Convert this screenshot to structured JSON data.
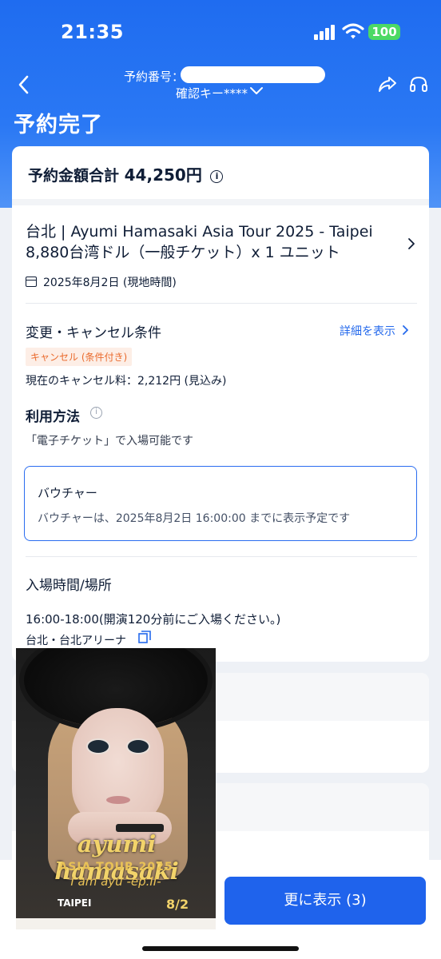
{
  "status_bar": {
    "time": "21:35",
    "battery": "100"
  },
  "nav": {
    "booking_label": "予約番号：",
    "confirm_key": "確認キー****"
  },
  "page_title": "予約完了",
  "summary": {
    "total_label": "予約金額合計",
    "total_amount": "44,250円"
  },
  "event": {
    "title_line1": "台北 | Ayumi Hamasaki Asia Tour 2025 - Taipei",
    "title_line2": "8,880台湾ドル（一般チケット）x 1 ユニット",
    "date": "2025年8月2日 (現地時間)"
  },
  "cancellation": {
    "heading": "変更・キャンセル条件",
    "details_link": "詳細を表示",
    "badge": "キャンセル (条件付き)",
    "fee": "現在のキャンセル料：2,212円 (見込み)"
  },
  "usage": {
    "heading": "利用方法",
    "text": "「電子チケット」で入場可能です"
  },
  "voucher": {
    "title": "バウチャー",
    "text": "バウチャーは、2025年8月2日 16:00:00 までに表示予定です"
  },
  "entry": {
    "heading": "入場時間/場所",
    "time": "16:00-18:00(開演120分前にご入場ください。)",
    "place": "台北・台北アリーナ"
  },
  "bottom_bar": {
    "more_button": "更に表示 (3)"
  },
  "poster": {
    "logo_text": "ayumi hamasaki",
    "tour_text": "ASIA TOUR 2025",
    "subtitle": "I am ayu -ep.II-",
    "city": "TAIPEI",
    "date": "8/2"
  },
  "colors": {
    "header_blue": "#1f6cf0",
    "link_blue": "#2469ec",
    "button_blue": "#1f63ec",
    "badge_orange": "#ea6a2c",
    "battery_green": "#4cd964"
  }
}
